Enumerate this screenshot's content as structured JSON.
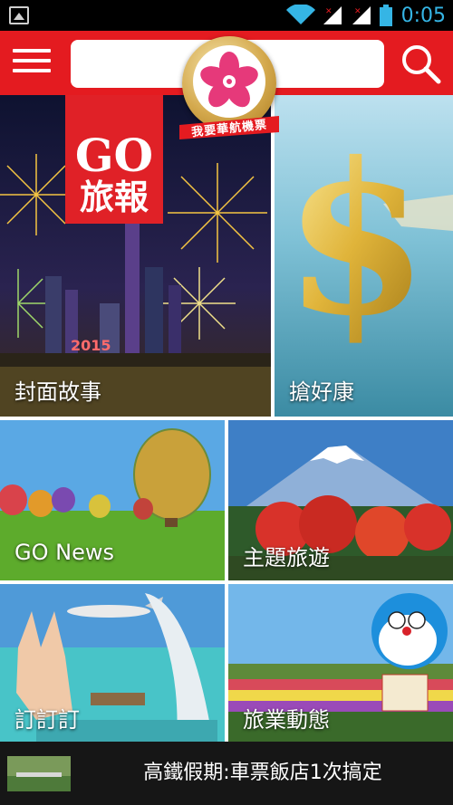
{
  "status_bar": {
    "time": "0:05"
  },
  "app_bar": {
    "search": {
      "value": "",
      "placeholder": ""
    },
    "logo_ribbon_text": "我要華航機票",
    "accent_color": "#e41b20"
  },
  "tiles": {
    "cover": {
      "label": "封面故事",
      "banner_title": "GO",
      "banner_subtitle": "旅報",
      "image_year": "2015"
    },
    "deals": {
      "label": "搶好康"
    },
    "news": {
      "label": "GO News"
    },
    "themes": {
      "label": "主題旅遊"
    },
    "ding": {
      "label": "訂訂訂"
    },
    "industry": {
      "label": "旅業動態"
    }
  },
  "ad_bar": {
    "text": "高鐵假期:車票飯店1次搞定"
  },
  "icons": [
    "image-icon",
    "wifi-icon",
    "signal-icon",
    "battery-icon",
    "menu-icon",
    "search-icon",
    "plum-blossom-logo-icon"
  ]
}
